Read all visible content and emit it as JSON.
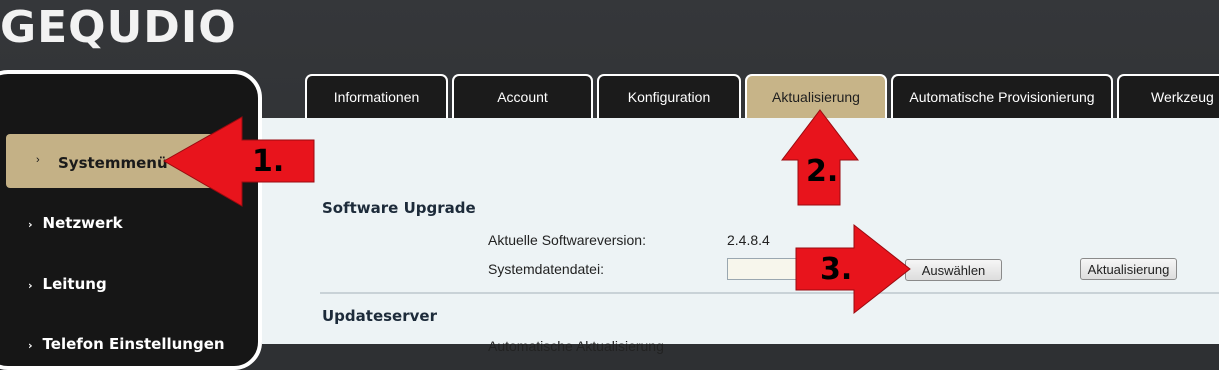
{
  "brand": {
    "logo_text": "GEQUDIO"
  },
  "tabs": [
    {
      "label": "Informationen"
    },
    {
      "label": "Account"
    },
    {
      "label": "Konfiguration"
    },
    {
      "label": "Aktualisierung",
      "active": true
    },
    {
      "label": "Automatische Provisionierung"
    },
    {
      "label": "Werkzeug"
    }
  ],
  "sidebar": {
    "items": [
      {
        "label": "Systemmenü",
        "active": true
      },
      {
        "label": "Netzwerk"
      },
      {
        "label": "Leitung"
      },
      {
        "label": "Telefon Einstellungen"
      }
    ]
  },
  "software_upgrade": {
    "title": "Software Upgrade",
    "current_version_label": "Aktuelle Softwareversion:",
    "current_version_value": "2.4.8.4",
    "system_file_label": "Systemdatendatei:",
    "choose_button": "Auswählen",
    "update_button": "Aktualisierung"
  },
  "update_server": {
    "title": "Updateserver",
    "auto_update_label": "Automatische Aktualisierung"
  },
  "annotations": [
    {
      "label": "1."
    },
    {
      "label": "2."
    },
    {
      "label": "3."
    }
  ],
  "colors": {
    "active_tab": "#c7b488",
    "active_sidebar": "#c4b186",
    "arrow_red": "#e8141c",
    "content_bg": "#edf3f5"
  }
}
